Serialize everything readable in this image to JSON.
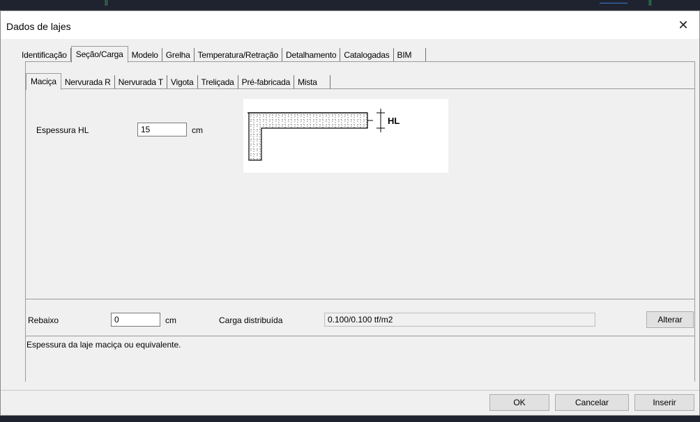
{
  "window": {
    "title": "Dados de lajes"
  },
  "main_tabs": [
    {
      "label": "Identificação"
    },
    {
      "label": "Seção/Carga"
    },
    {
      "label": "Modelo"
    },
    {
      "label": "Grelha"
    },
    {
      "label": "Temperatura/Retração"
    },
    {
      "label": "Detalhamento"
    },
    {
      "label": "Catalogadas"
    },
    {
      "label": "BIM"
    }
  ],
  "sub_tabs": [
    {
      "label": "Maciça"
    },
    {
      "label": "Nervurada R"
    },
    {
      "label": "Nervurada T"
    },
    {
      "label": "Vigota"
    },
    {
      "label": "Treliçada"
    },
    {
      "label": "Pré-fabricada"
    },
    {
      "label": "Mista"
    }
  ],
  "espessura": {
    "label": "Espessura HL",
    "value": "15",
    "unit": "cm"
  },
  "diagram": {
    "label": "HL"
  },
  "rebaixo": {
    "label": "Rebaixo",
    "value": "0",
    "unit": "cm"
  },
  "carga": {
    "label": "Carga distribuída",
    "value": "0.100/0.100 tf/m2",
    "button": "Alterar"
  },
  "message": "Espessura da laje maciça ou equivalente.",
  "buttons": {
    "ok": "OK",
    "cancel": "Cancelar",
    "insert": "Inserir"
  },
  "colors": {
    "window_bg": "#f0f0f0",
    "title_bg": "#ffffff",
    "button_bg": "#e1e1e1"
  }
}
